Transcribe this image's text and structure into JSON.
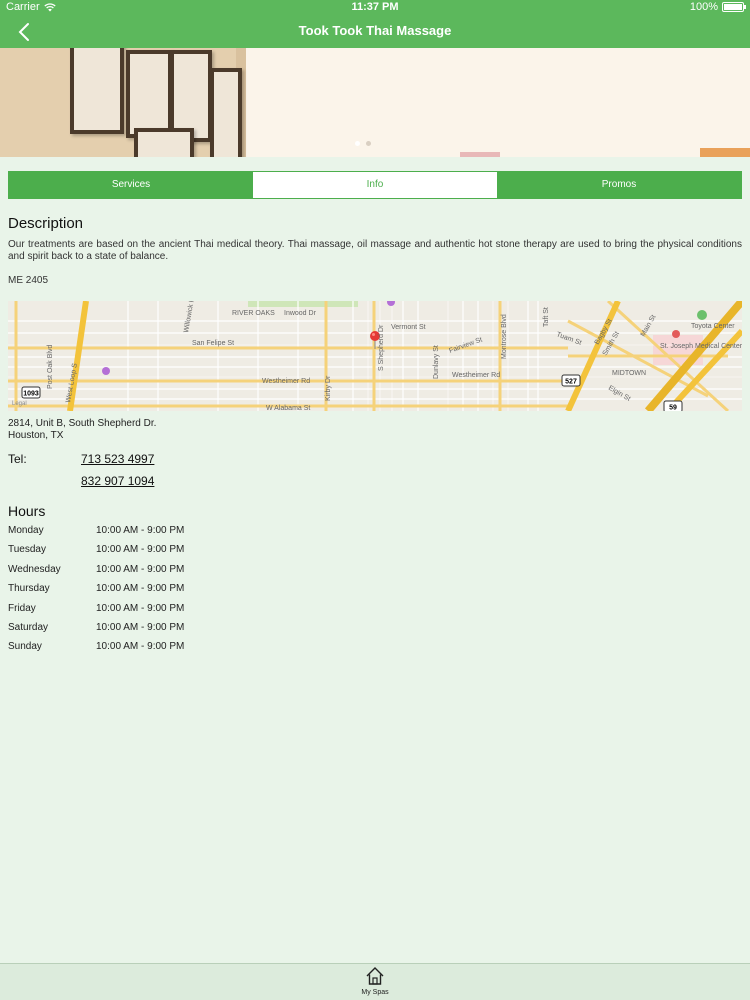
{
  "status": {
    "carrier": "Carrier",
    "time": "11:37 PM",
    "battery": "100%"
  },
  "nav": {
    "title": "Took Took Thai Massage"
  },
  "tabs": [
    {
      "label": "Services",
      "active": false
    },
    {
      "label": "Info",
      "active": true
    },
    {
      "label": "Promos",
      "active": false
    }
  ],
  "description": {
    "heading": "Description",
    "text": "Our treatments are based on the ancient Thai medical theory. Thai massage, oil massage and authentic hot stone therapy are used to bring the physical conditions and spirit back to a state of balance.",
    "code": "ME 2405"
  },
  "map": {
    "street_labels": [
      "RIVER OAKS",
      "Inwood Dr",
      "Vermont St",
      "San Felipe St",
      "Fairview St",
      "Westheimer Rd",
      "Westheimer Rd",
      "W Alabama St",
      "Kirby Dr",
      "S Shepherd Dr",
      "Dunlavy St",
      "Montrose Blvd",
      "Taft St",
      "Bagby St",
      "Smith St",
      "Main St",
      "Elgin St",
      "MIDTOWN",
      "West Loop S",
      "Post Oak Blvd",
      "Willowick Rd",
      "Toyota Center",
      "St. Joseph Medical Center",
      "Tuam St"
    ],
    "shields": [
      "1093",
      "527",
      "59"
    ]
  },
  "address": {
    "line1": "2814, Unit B, South Shepherd Dr.",
    "line2": "Houston, TX"
  },
  "tel": {
    "label": "Tel:",
    "phones": [
      "713 523 4997",
      "832 907 1094"
    ]
  },
  "hours": {
    "heading": "Hours",
    "rows": [
      {
        "day": "Monday",
        "time": "10:00 AM - 9:00 PM"
      },
      {
        "day": "Tuesday",
        "time": "10:00 AM - 9:00 PM"
      },
      {
        "day": "Wednesday",
        "time": "10:00 AM - 9:00 PM"
      },
      {
        "day": "Thursday",
        "time": "10:00 AM - 9:00 PM"
      },
      {
        "day": "Friday",
        "time": "10:00 AM - 9:00 PM"
      },
      {
        "day": "Saturday",
        "time": "10:00 AM - 9:00 PM"
      },
      {
        "day": "Sunday",
        "time": "10:00 AM - 9:00 PM"
      }
    ]
  },
  "tabbar": {
    "label": "My Spas",
    "icon": "home-icon"
  },
  "colors": {
    "brand_green": "#5cb85c",
    "tab_green": "#4cae4c",
    "background": "#e9f4e9"
  }
}
